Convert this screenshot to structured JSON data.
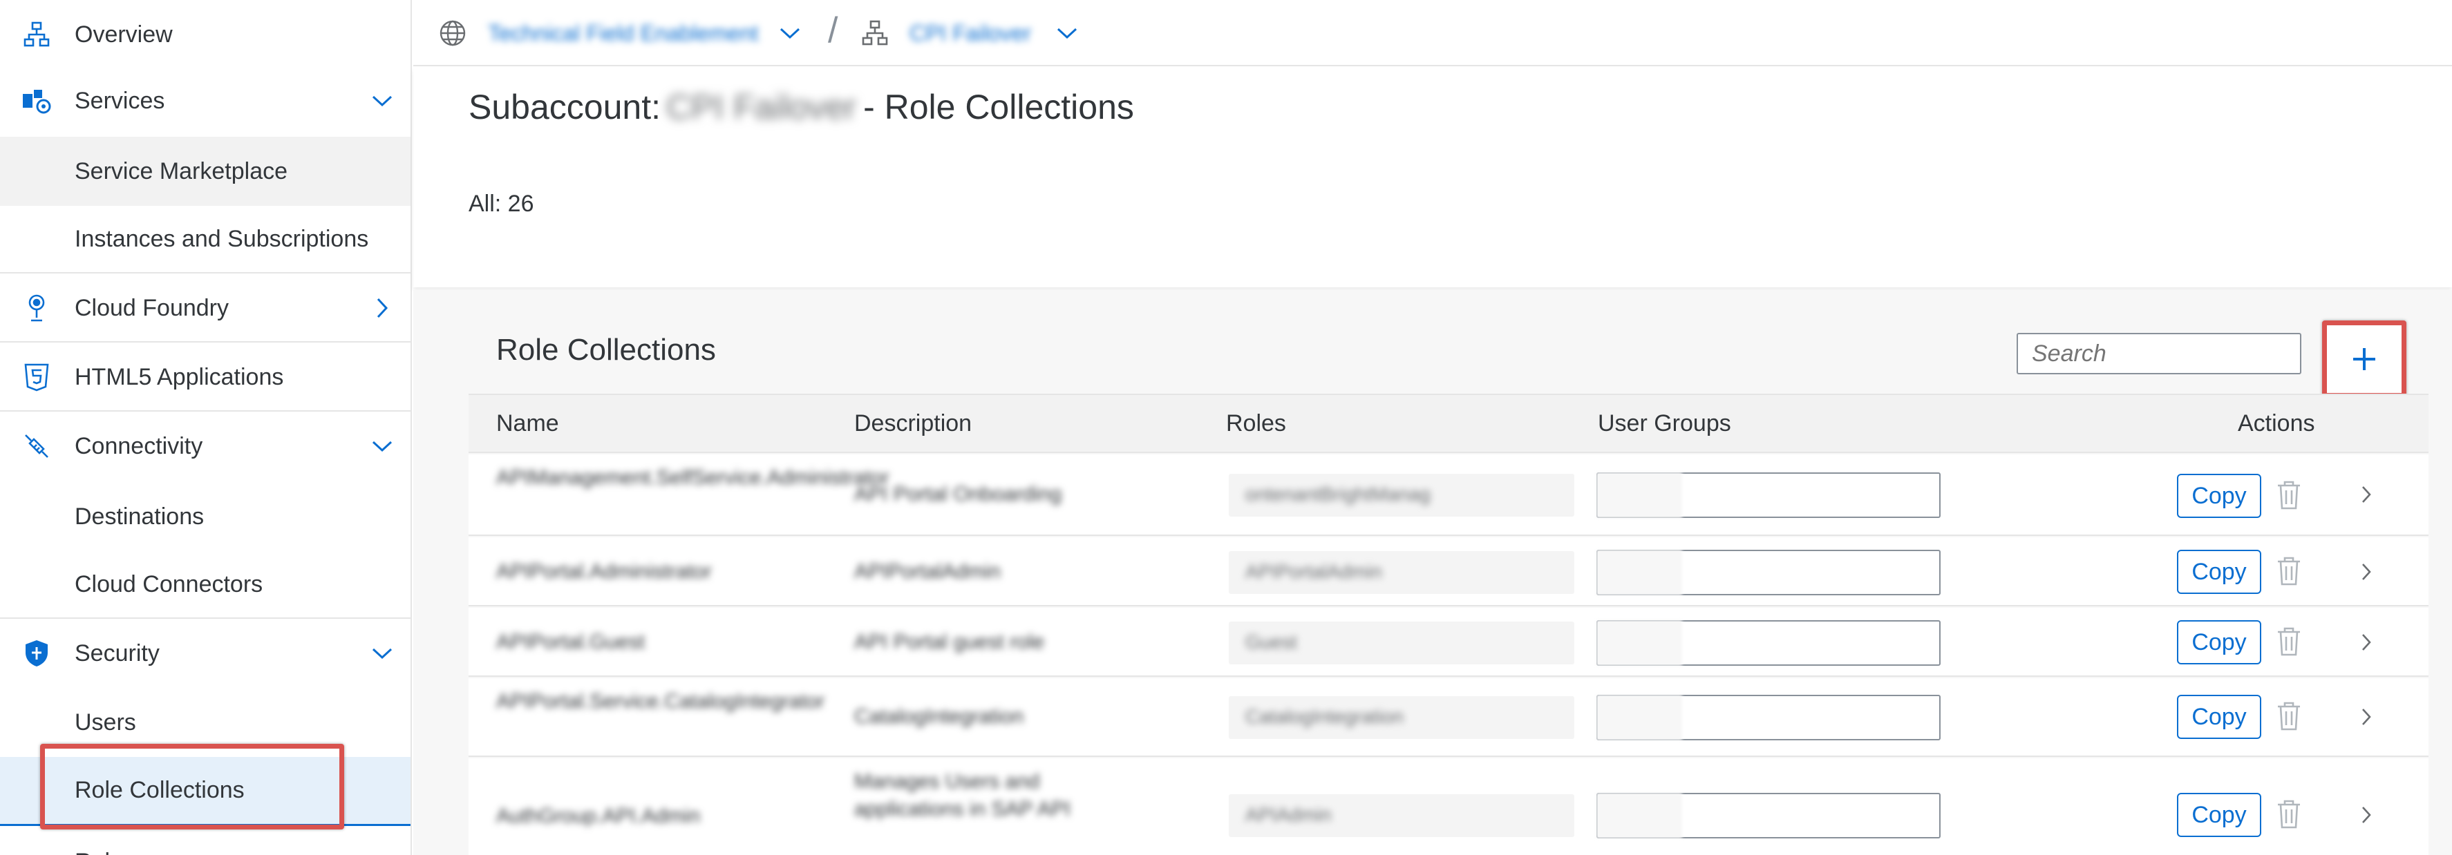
{
  "sidebar": {
    "items": [
      {
        "label": "Overview",
        "icon": "hierarchy-icon"
      },
      {
        "label": "Services",
        "icon": "services-icon",
        "expanded": true
      },
      {
        "label": "Service Marketplace"
      },
      {
        "label": "Instances and Subscriptions"
      },
      {
        "label": "Cloud Foundry",
        "icon": "cloud-foundry-icon",
        "expanded": false
      },
      {
        "label": "HTML5 Applications",
        "icon": "html5-icon"
      },
      {
        "label": "Connectivity",
        "icon": "connectivity-icon",
        "expanded": true
      },
      {
        "label": "Destinations"
      },
      {
        "label": "Cloud Connectors"
      },
      {
        "label": "Security",
        "icon": "shield-icon",
        "expanded": true
      },
      {
        "label": "Users"
      },
      {
        "label": "Role Collections",
        "selected": true
      },
      {
        "label": "Roles"
      }
    ]
  },
  "topbar": {
    "global_account": "Technical Field Enablement",
    "subaccount": "CPI Failover"
  },
  "header": {
    "title_prefix": "Subaccount:",
    "subaccount_name": "CPI Failover",
    "title_suffix": "- Role Collections",
    "count": "All: 26"
  },
  "table": {
    "title": "Role Collections",
    "search_placeholder": "Search",
    "add_label": "+",
    "columns": [
      "Name",
      "Description",
      "Roles",
      "User Groups",
      "Actions"
    ],
    "copy_label": "Copy",
    "rows": [
      {
        "name": "APIManagement.SelfService.Administrator",
        "description": "API Portal Onboarding",
        "roles": "ontenantBrightManag"
      },
      {
        "name": "APIPortal.Administrator",
        "description": "APIPortalAdmin",
        "roles": "APIPortalAdmin"
      },
      {
        "name": "APIPortal.Guest",
        "description": "API Portal guest role",
        "roles": "Guest"
      },
      {
        "name": "APIPortal.Service.CatalogIntegrator",
        "description": "CatalogIntegration",
        "roles": "CatalogIntegration"
      },
      {
        "name": "AuthGroup.API.Admin",
        "description": "Manages Users and applications in SAP API",
        "roles": "APIAdmin"
      }
    ]
  },
  "colors": {
    "accent": "#0a6ed1",
    "highlight": "#d9534f",
    "text": "#32363a"
  }
}
